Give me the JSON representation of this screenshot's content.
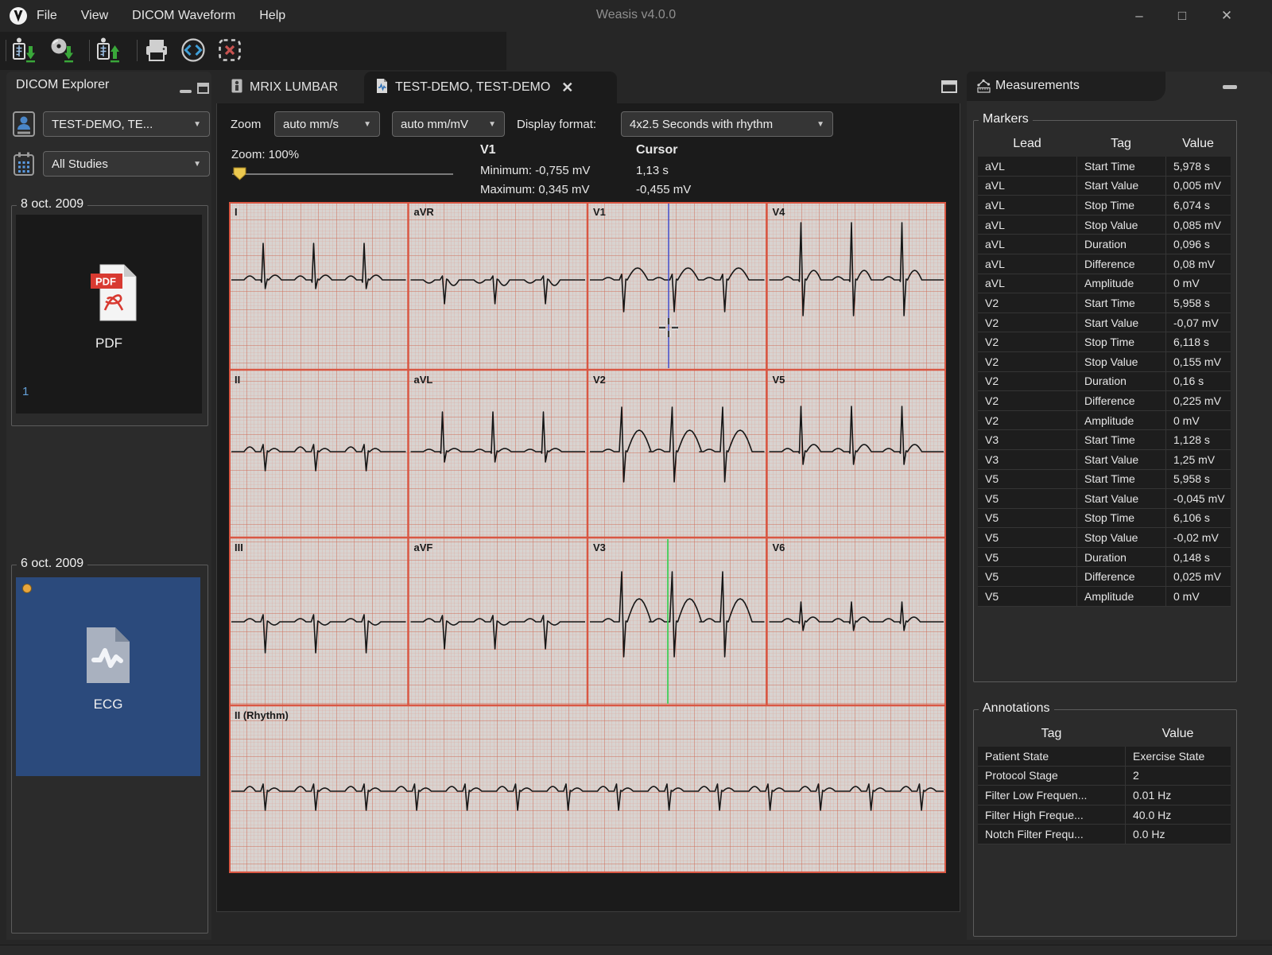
{
  "window": {
    "logo": "V",
    "title": "Weasis v4.0.0",
    "menus": [
      "File",
      "View",
      "DICOM Waveform",
      "Help"
    ]
  },
  "toolbar": {
    "icons": [
      "dicom-import",
      "cd-import",
      "dicom-export",
      "print",
      "dicom-code",
      "close-exam"
    ]
  },
  "explorer": {
    "title": "DICOM Explorer",
    "patient_selected": "TEST-DEMO, TE...",
    "study_selected": "All Studies",
    "groups": [
      {
        "date": "8 oct. 2009",
        "item_label": "PDF",
        "badge": "1",
        "kind": "pdf"
      },
      {
        "date": "6 oct. 2009",
        "item_label": "ECG",
        "kind": "ecg"
      }
    ]
  },
  "tabs": [
    {
      "label": "MRIX LUMBAR",
      "active": false
    },
    {
      "label": "TEST-DEMO, TEST-DEMO",
      "active": true
    }
  ],
  "viewer": {
    "zoom_label": "Zoom",
    "speed_value": "auto mm/s",
    "gain_value": "auto mm/mV",
    "format_label": "Display format:",
    "format_value": "4x2.5 Seconds with rhythm",
    "zoom_level": "Zoom: 100%",
    "selection": {
      "lead": "V1",
      "minimum": "Minimum: -0,755 mV",
      "maximum": "Maximum: 0,345 mV"
    },
    "cursor": {
      "title": "Cursor",
      "time": "1,13 s",
      "value": "-0,455 mV"
    }
  },
  "ecg": {
    "lead_rows": [
      [
        "I",
        "aVR",
        "V1",
        "V4"
      ],
      [
        "II",
        "aVL",
        "V2",
        "V5"
      ],
      [
        "III",
        "aVF",
        "V3",
        "V6"
      ]
    ],
    "rhythm_label": "II (Rhythm)"
  },
  "measurements": {
    "title": "Measurements",
    "markers": {
      "legend": "Markers",
      "columns": [
        "Lead",
        "Tag",
        "Value"
      ],
      "rows": [
        [
          "aVL",
          "Start Time",
          "5,978 s"
        ],
        [
          "aVL",
          "Start Value",
          "0,005 mV"
        ],
        [
          "aVL",
          "Stop Time",
          "6,074 s"
        ],
        [
          "aVL",
          "Stop Value",
          "0,085 mV"
        ],
        [
          "aVL",
          "Duration",
          "0,096 s"
        ],
        [
          "aVL",
          "Difference",
          "0,08 mV"
        ],
        [
          "aVL",
          "Amplitude",
          "0 mV"
        ],
        [
          "V2",
          "Start Time",
          "5,958 s"
        ],
        [
          "V2",
          "Start Value",
          "-0,07 mV"
        ],
        [
          "V2",
          "Stop Time",
          "6,118 s"
        ],
        [
          "V2",
          "Stop Value",
          "0,155 mV"
        ],
        [
          "V2",
          "Duration",
          "0,16 s"
        ],
        [
          "V2",
          "Difference",
          "0,225 mV"
        ],
        [
          "V2",
          "Amplitude",
          "0 mV"
        ],
        [
          "V3",
          "Start Time",
          "1,128 s"
        ],
        [
          "V3",
          "Start Value",
          "1,25 mV"
        ],
        [
          "V5",
          "Start Time",
          "5,958 s"
        ],
        [
          "V5",
          "Start Value",
          "-0,045 mV"
        ],
        [
          "V5",
          "Stop Time",
          "6,106 s"
        ],
        [
          "V5",
          "Stop Value",
          "-0,02 mV"
        ],
        [
          "V5",
          "Duration",
          "0,148 s"
        ],
        [
          "V5",
          "Difference",
          "0,025 mV"
        ],
        [
          "V5",
          "Amplitude",
          "0 mV"
        ]
      ]
    },
    "annotations": {
      "legend": "Annotations",
      "columns": [
        "Tag",
        "Value"
      ],
      "rows": [
        [
          "Patient State",
          "Exercise State"
        ],
        [
          "Protocol Stage",
          "2"
        ],
        [
          "Filter Low Frequen...",
          "0.01 Hz"
        ],
        [
          "Filter High Freque...",
          "40.0 Hz"
        ],
        [
          "Notch Filter Frequ...",
          "0.0 Hz"
        ]
      ]
    }
  },
  "colors": {
    "accent_blue": "#4a86c8",
    "cursor_blue": "#3a49cf",
    "marker_green": "#41cf5a",
    "paper": "#d8d3d0",
    "grid_minor": "#dda79c",
    "grid_major": "#cf6c58",
    "grid_bold": "#d95743",
    "pdf_red": "#d83a31",
    "thumb_blue": "#2b4a7c",
    "slider_yellow": "#ecc94f"
  }
}
